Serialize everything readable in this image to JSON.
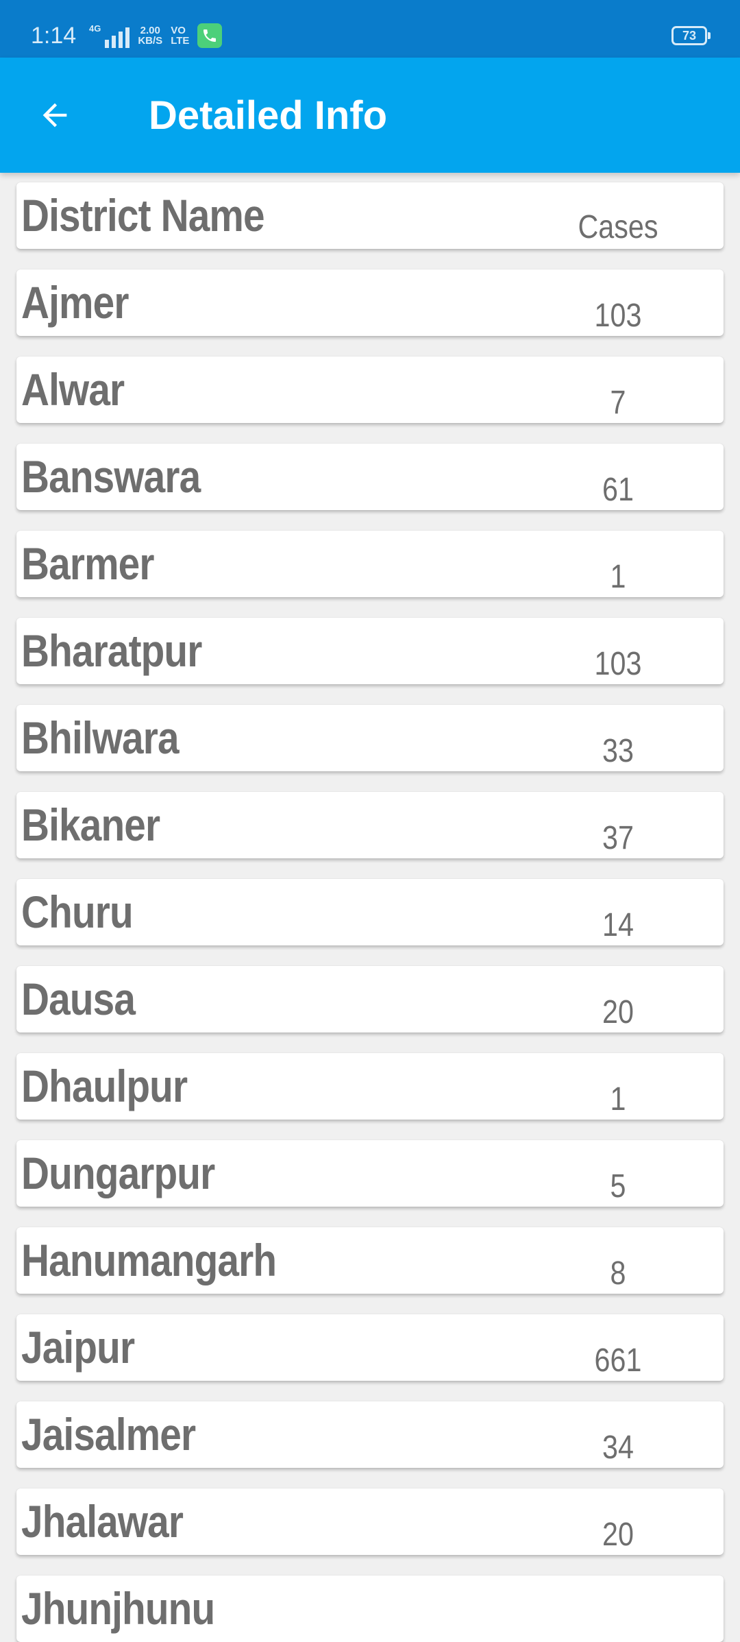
{
  "status_bar": {
    "time": "1:14",
    "network": "4G",
    "speed_value": "2.00",
    "speed_unit": "KB/S",
    "volte_top": "VO",
    "volte_bottom": "LTE",
    "battery": "73"
  },
  "app_bar": {
    "title": "Detailed Info",
    "back_icon": "arrow-left-icon"
  },
  "table": {
    "header": {
      "name": "District Name",
      "cases": "Cases"
    },
    "rows": [
      {
        "name": "Ajmer",
        "cases": "103"
      },
      {
        "name": "Alwar",
        "cases": "7"
      },
      {
        "name": "Banswara",
        "cases": "61"
      },
      {
        "name": "Barmer",
        "cases": "1"
      },
      {
        "name": "Bharatpur",
        "cases": "103"
      },
      {
        "name": "Bhilwara",
        "cases": "33"
      },
      {
        "name": "Bikaner",
        "cases": "37"
      },
      {
        "name": "Churu",
        "cases": "14"
      },
      {
        "name": "Dausa",
        "cases": "20"
      },
      {
        "name": "Dhaulpur",
        "cases": "1"
      },
      {
        "name": "Dungarpur",
        "cases": "5"
      },
      {
        "name": "Hanumangarh",
        "cases": "8"
      },
      {
        "name": "Jaipur",
        "cases": "661"
      },
      {
        "name": "Jaisalmer",
        "cases": "34"
      },
      {
        "name": "Jhalawar",
        "cases": "20"
      },
      {
        "name": "Jhunjhunu",
        "cases": ""
      }
    ]
  },
  "colors": {
    "status_bar": "#0a7ccb",
    "app_bar": "#03a5ee",
    "text": "#6e6e6e",
    "background": "#f0f0f0",
    "card": "#ffffff"
  }
}
